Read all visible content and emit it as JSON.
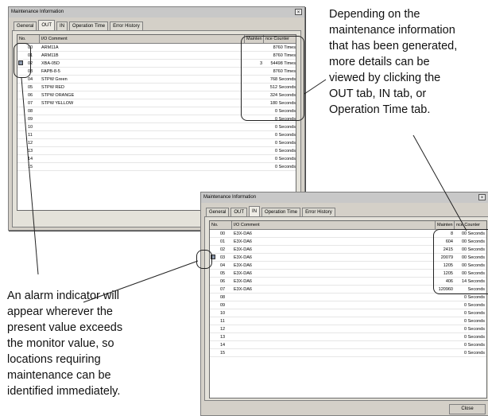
{
  "window1": {
    "title": "Maintenance Information",
    "close_glyph": "×",
    "tabs": [
      "General",
      "OUT",
      "IN",
      "Operation Time",
      "Error History"
    ],
    "active_tab": 1,
    "columns": [
      "No.",
      "I/O Comment",
      "Mainten",
      "nce Counter"
    ],
    "rows": [
      {
        "no": "00",
        "comment": "ARM11A",
        "mv": "",
        "counter": "8760 Times",
        "alarm": false
      },
      {
        "no": "01",
        "comment": "ARM11B",
        "mv": "",
        "counter": "8760 Times",
        "alarm": false
      },
      {
        "no": "02",
        "comment": "XBA-05D",
        "mv": "3",
        "counter": "54498 Times",
        "alarm": true
      },
      {
        "no": "03",
        "comment": "FAPB-8-5",
        "mv": "",
        "counter": "8760 Times",
        "alarm": false
      },
      {
        "no": "04",
        "comment": "STPW Green",
        "mv": "",
        "counter": "768 Seconds",
        "alarm": false
      },
      {
        "no": "05",
        "comment": "STPW RED",
        "mv": "",
        "counter": "512 Seconds",
        "alarm": false
      },
      {
        "no": "06",
        "comment": "STPW ORANGE",
        "mv": "",
        "counter": "324 Seconds",
        "alarm": false
      },
      {
        "no": "07",
        "comment": "STPW YELLOW",
        "mv": "",
        "counter": "180 Seconds",
        "alarm": false
      },
      {
        "no": "08",
        "comment": "",
        "mv": "",
        "counter": "0 Seconds",
        "alarm": false
      },
      {
        "no": "09",
        "comment": "",
        "mv": "",
        "counter": "0 Seconds",
        "alarm": false
      },
      {
        "no": "10",
        "comment": "",
        "mv": "",
        "counter": "0 Seconds",
        "alarm": false
      },
      {
        "no": "11",
        "comment": "",
        "mv": "",
        "counter": "0 Seconds",
        "alarm": false
      },
      {
        "no": "12",
        "comment": "",
        "mv": "",
        "counter": "0 Seconds",
        "alarm": false
      },
      {
        "no": "13",
        "comment": "",
        "mv": "",
        "counter": "0 Seconds",
        "alarm": false
      },
      {
        "no": "14",
        "comment": "",
        "mv": "",
        "counter": "0 Seconds",
        "alarm": false
      },
      {
        "no": "15",
        "comment": "",
        "mv": "",
        "counter": "0 Seconds",
        "alarm": false
      }
    ]
  },
  "window2": {
    "title": "Maintenance Information",
    "close_glyph": "×",
    "tabs": [
      "General",
      "OUT",
      "IN",
      "Operation Time",
      "Error History"
    ],
    "active_tab": 2,
    "columns": [
      "No.",
      "I/O Comment",
      "Mainten",
      "nce Counter"
    ],
    "rows": [
      {
        "no": "00",
        "comment": "E3X-DA6",
        "mv": "8",
        "counter": "00 Seconds",
        "alarm": false
      },
      {
        "no": "01",
        "comment": "E3X-DA6",
        "mv": "604",
        "counter": "00 Seconds",
        "alarm": false
      },
      {
        "no": "02",
        "comment": "E3X-DA6",
        "mv": "2415",
        "counter": "00 Seconds",
        "alarm": false
      },
      {
        "no": "03",
        "comment": "E3X-DA6",
        "mv": "20079",
        "counter": "00 Seconds",
        "alarm": true
      },
      {
        "no": "04",
        "comment": "E3X-DA6",
        "mv": "1205",
        "counter": "00 Seconds",
        "alarm": false
      },
      {
        "no": "05",
        "comment": "E3X-DA6",
        "mv": "1205",
        "counter": "00 Seconds",
        "alarm": false
      },
      {
        "no": "06",
        "comment": "E3X-DA6",
        "mv": "406",
        "counter": "14 Seconds",
        "alarm": false
      },
      {
        "no": "07",
        "comment": "E3X-DA6",
        "mv": "120960",
        "counter": "Seconds",
        "alarm": false
      },
      {
        "no": "08",
        "comment": "",
        "mv": "",
        "counter": "0 Seconds",
        "alarm": false
      },
      {
        "no": "09",
        "comment": "",
        "mv": "",
        "counter": "0 Seconds",
        "alarm": false
      },
      {
        "no": "10",
        "comment": "",
        "mv": "",
        "counter": "0 Seconds",
        "alarm": false
      },
      {
        "no": "11",
        "comment": "",
        "mv": "",
        "counter": "0 Seconds",
        "alarm": false
      },
      {
        "no": "12",
        "comment": "",
        "mv": "",
        "counter": "0 Seconds",
        "alarm": false
      },
      {
        "no": "13",
        "comment": "",
        "mv": "",
        "counter": "0 Seconds",
        "alarm": false
      },
      {
        "no": "14",
        "comment": "",
        "mv": "",
        "counter": "0 Seconds",
        "alarm": false
      },
      {
        "no": "15",
        "comment": "",
        "mv": "",
        "counter": "0 Seconds",
        "alarm": false
      }
    ],
    "close_button": "Close"
  },
  "callouts": {
    "right": [
      "Depending on the",
      "maintenance information",
      "that has been generated,",
      "more details can be",
      "viewed by clicking the",
      "OUT tab, IN tab, or",
      "Operation Time tab."
    ],
    "left": [
      "An alarm indicator will",
      "appear wherever the",
      "present value exceeds",
      "the monitor value, so",
      "locations requiring",
      "maintenance can be",
      "identified immediately."
    ]
  }
}
